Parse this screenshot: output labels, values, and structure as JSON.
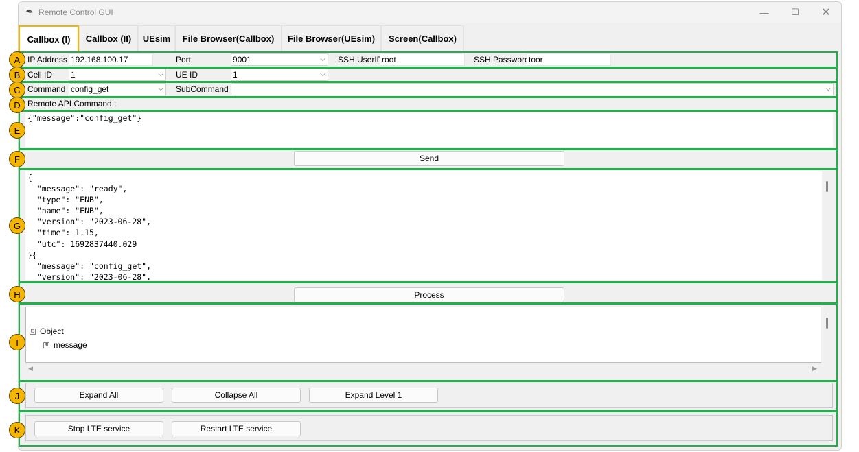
{
  "window": {
    "title": "Remote Control GUI"
  },
  "titlebar": {
    "minimize": "—",
    "maximize": "☐",
    "close": "✕"
  },
  "tabs": [
    {
      "label": "Callbox (I)",
      "active": true
    },
    {
      "label": "Callbox (II)"
    },
    {
      "label": "UEsim"
    },
    {
      "label": "File Browser(Callbox)"
    },
    {
      "label": "File Browser(UEsim)"
    },
    {
      "label": "Screen(Callbox)"
    }
  ],
  "row_a": {
    "ip_label": "IP Address",
    "ip_value": "192.168.100.17",
    "port_label": "Port",
    "port_value": "9001",
    "ssh_user_label": "SSH UserID",
    "ssh_user_value": "root",
    "ssh_pass_label": "SSH Password",
    "ssh_pass_value": "toor"
  },
  "row_b": {
    "cell_label": "Cell ID",
    "cell_value": "1",
    "ue_label": "UE ID",
    "ue_value": "1"
  },
  "row_c": {
    "command_label": "Command",
    "command_value": "config_get",
    "subcommand_label": "SubCommand",
    "subcommand_value": ""
  },
  "row_d": {
    "label": "Remote API Command :"
  },
  "row_e": {
    "command_text": "{\"message\":\"config_get\"}"
  },
  "row_f": {
    "send_label": "Send"
  },
  "row_g": {
    "response_text": "{\n  \"message\": \"ready\",\n  \"type\": \"ENB\",\n  \"name\": \"ENB\",\n  \"version\": \"2023-06-28\",\n  \"time\": 1.15,\n  \"utc\": 1692837440.029\n}{\n  \"message\": \"config_get\",\n  \"version\": \"2023-06-28\","
  },
  "row_h": {
    "process_label": "Process"
  },
  "row_i": {
    "tree": [
      {
        "label": "Object",
        "expander": "⊟"
      },
      {
        "label": "message",
        "expander": "⊞"
      }
    ],
    "hscroll_left": "◀",
    "hscroll_right": "▶"
  },
  "row_j": {
    "expand_all": "Expand All",
    "collapse_all": "Collapse All",
    "expand_level1": "Expand Level 1"
  },
  "row_k": {
    "stop_lte": "Stop LTE service",
    "restart_lte": "Restart LTE service"
  },
  "markers": [
    "A",
    "B",
    "C",
    "D",
    "E",
    "F",
    "G",
    "H",
    "I",
    "J",
    "K"
  ],
  "colors": {
    "highlight_green": "#1fb14a",
    "marker_yellow": "#f5b400",
    "active_tab_border": "#f5b400"
  },
  "icons": {
    "app_icon": "feather-icon",
    "dropdown": "chevron-down-icon"
  }
}
